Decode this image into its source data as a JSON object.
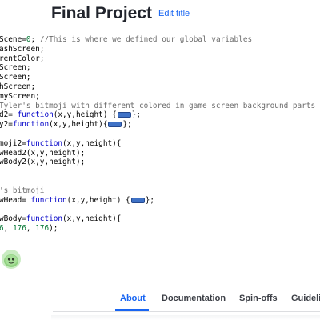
{
  "header": {
    "title": "Final Project",
    "edit_title": "Edit title"
  },
  "editor": {
    "lines": [
      {
        "segments": [
          {
            "t": "Scene=",
            "c": ""
          },
          {
            "t": "0",
            "c": "num"
          },
          {
            "t": "; ",
            "c": ""
          },
          {
            "t": "//This is where we defined our global variables",
            "c": "cmt"
          }
        ]
      },
      {
        "segments": [
          {
            "t": "ashScreen;",
            "c": ""
          }
        ]
      },
      {
        "segments": [
          {
            "t": "rentColor;",
            "c": ""
          }
        ]
      },
      {
        "segments": [
          {
            "t": "Screen;",
            "c": ""
          }
        ]
      },
      {
        "segments": [
          {
            "t": "Screen;",
            "c": ""
          }
        ]
      },
      {
        "segments": [
          {
            "t": "hScreen;",
            "c": ""
          }
        ]
      },
      {
        "segments": [
          {
            "t": "myScreen;",
            "c": ""
          }
        ]
      },
      {
        "segments": [
          {
            "t": "Tyler's bitmoji with different colored in game screen background parts",
            "c": "cmt"
          }
        ]
      },
      {
        "segments": [
          {
            "t": "d2= ",
            "c": ""
          },
          {
            "t": "function",
            "c": "kw"
          },
          {
            "t": "(x,y,height) {",
            "c": ""
          },
          {
            "fold": true
          },
          {
            "t": "};",
            "c": ""
          }
        ]
      },
      {
        "segments": [
          {
            "t": "y2=",
            "c": ""
          },
          {
            "t": "function",
            "c": "kw"
          },
          {
            "t": "(x,y,height){",
            "c": ""
          },
          {
            "fold": true
          },
          {
            "t": "};",
            "c": ""
          }
        ]
      },
      {
        "segments": [
          {
            "t": "",
            "c": ""
          }
        ]
      },
      {
        "segments": [
          {
            "t": "moji2=",
            "c": ""
          },
          {
            "t": "function",
            "c": "kw"
          },
          {
            "t": "(x,y,height){",
            "c": ""
          }
        ]
      },
      {
        "segments": [
          {
            "t": "wHead2(x,y,height);",
            "c": ""
          }
        ]
      },
      {
        "segments": [
          {
            "t": "wBody2(x,y,height);",
            "c": ""
          }
        ]
      },
      {
        "segments": [
          {
            "t": "",
            "c": ""
          }
        ]
      },
      {
        "segments": [
          {
            "t": "",
            "c": ""
          }
        ]
      },
      {
        "segments": [
          {
            "t": "'s bitmoji",
            "c": "cmt"
          }
        ]
      },
      {
        "segments": [
          {
            "t": "wHead= ",
            "c": ""
          },
          {
            "t": "function",
            "c": "kw"
          },
          {
            "t": "(x,y,height) {",
            "c": ""
          },
          {
            "fold": true
          },
          {
            "t": "};",
            "c": ""
          }
        ]
      },
      {
        "segments": [
          {
            "t": "",
            "c": ""
          }
        ]
      },
      {
        "segments": [
          {
            "t": "wBody=",
            "c": ""
          },
          {
            "t": "function",
            "c": "kw"
          },
          {
            "t": "(x,y,height){",
            "c": ""
          }
        ]
      },
      {
        "segments": [
          {
            "t": "6",
            "c": "num"
          },
          {
            "t": ", ",
            "c": ""
          },
          {
            "t": "176",
            "c": "num"
          },
          {
            "t": ", ",
            "c": ""
          },
          {
            "t": "176",
            "c": "num"
          },
          {
            "t": ");",
            "c": ""
          }
        ]
      }
    ]
  },
  "avatar": {
    "icon": "green-blob-avatar-icon",
    "color": "#c9ecc2"
  },
  "tabs": [
    {
      "label": "About",
      "active": true
    },
    {
      "label": "Documentation",
      "active": false
    },
    {
      "label": "Spin-offs",
      "active": false
    },
    {
      "label": "Guidelin",
      "active": false
    }
  ],
  "colors": {
    "accent": "#1865f2",
    "keyword": "#0000c8",
    "comment": "#6b6b6b",
    "number": "#0b7a3a",
    "fold_marker": "#3f72c6"
  }
}
